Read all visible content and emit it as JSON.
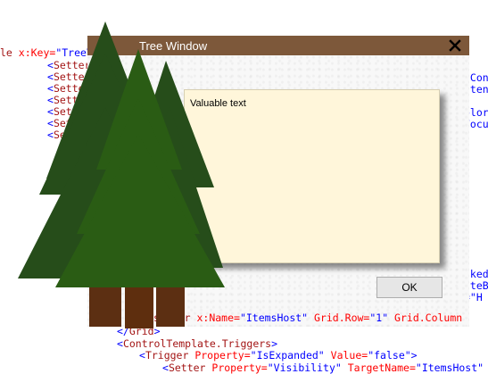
{
  "window": {
    "title": "Tree Window",
    "close_glyph": "✕",
    "note_text": "Valuable text",
    "ok_label": "OK"
  },
  "code": {
    "lines": [
      "le x:Key=\"TreeVi",
      "<Setter",
      "<Sette",
      "<Sette",
      "<Sett",
      "<Set",
      "<Set",
      "<Set",
      "lCon",
      "ntent",
      "olor",
      "Focu",
      "cked",
      "ateB",
      "=\"H",
      "senter x:Name=\"ItemsHost\" Grid.Row=\"1\" Grid.Column",
      "</Grid>",
      "<ControlTemplate.Triggers>",
      "<Trigger Property=\"IsExpanded\" Value=\"false\">",
      "<Setter Property=\"Visibility\" TargetName=\"ItemsHost\" Va"
    ]
  },
  "colors": {
    "titlebar": "#7d583a",
    "note_bg": "#fff6da",
    "tree_dark": "#264d1a",
    "tree_mid": "#2a5c14",
    "tree_light": "#2f6b12",
    "trunk": "#5c2f12"
  }
}
